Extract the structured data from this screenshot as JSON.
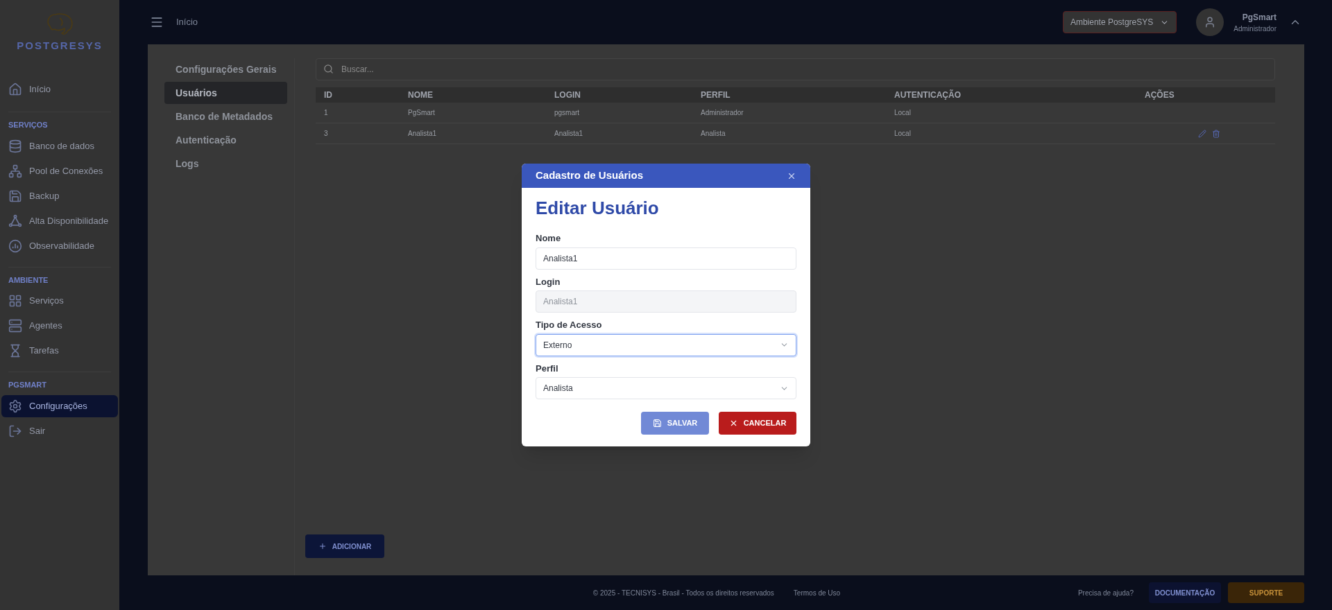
{
  "logo": {
    "text": "POSTGRESYS"
  },
  "sidebar": {
    "groups": [
      {
        "items": [
          {
            "label": "Início",
            "selected": false
          }
        ]
      },
      {
        "heading": "SERVIÇOS",
        "items": [
          {
            "label": "Banco de dados",
            "selected": false
          },
          {
            "label": "Pool de Conexões",
            "selected": false
          },
          {
            "label": "Backup",
            "selected": false
          },
          {
            "label": "Alta Disponibilidade",
            "selected": false
          },
          {
            "label": "Observabilidade",
            "selected": false
          }
        ]
      },
      {
        "heading": "AMBIENTE",
        "items": [
          {
            "label": "Serviços",
            "selected": false
          },
          {
            "label": "Agentes",
            "selected": false
          },
          {
            "label": "Tarefas",
            "selected": false
          }
        ]
      },
      {
        "heading": "PGSMART",
        "items": [
          {
            "label": "Configurações",
            "selected": true
          },
          {
            "label": "Sair",
            "selected": false
          }
        ]
      }
    ]
  },
  "topbar": {
    "breadcrumb": "Início",
    "environment": "Ambiente PostgreSYS",
    "user": {
      "name": "PgSmart",
      "role": "Administrador"
    }
  },
  "settings_nav": [
    {
      "label": "Configurações Gerais",
      "selected": false
    },
    {
      "label": "Usuários",
      "selected": true
    },
    {
      "label": "Banco de Metadados",
      "selected": false
    },
    {
      "label": "Autenticação",
      "selected": false
    },
    {
      "label": "Logs",
      "selected": false
    }
  ],
  "search": {
    "placeholder": "Buscar..."
  },
  "table": {
    "columns": [
      "ID",
      "NOME",
      "LOGIN",
      "PERFIL",
      "AUTENTICAÇÃO",
      "AÇÕES"
    ],
    "rows": [
      {
        "cells": [
          "1",
          "PgSmart",
          "pgsmart",
          "Administrador",
          "Local"
        ],
        "editable": false
      },
      {
        "cells": [
          "3",
          "Analista1",
          "Analista1",
          "Analista",
          "Local"
        ],
        "editable": true
      }
    ]
  },
  "add_button": "ADICIONAR",
  "modal": {
    "header": "Cadastro de Usuários",
    "title": "Editar Usuário",
    "fields": [
      {
        "label": "Nome",
        "kind": "input",
        "value": "Analista1",
        "disabled": false,
        "focused": false
      },
      {
        "label": "Login",
        "kind": "input",
        "value": "Analista1",
        "disabled": true,
        "focused": false
      },
      {
        "label": "Tipo de Acesso",
        "kind": "select",
        "value": "Externo",
        "disabled": false,
        "focused": true
      },
      {
        "label": "Perfil",
        "kind": "select",
        "value": "Analista",
        "disabled": false,
        "focused": false
      }
    ],
    "buttons": [
      {
        "label": "SALVAR",
        "kind": "save"
      },
      {
        "label": "CANCELAR",
        "kind": "cancel"
      }
    ]
  },
  "footer": {
    "copyright": "© 2025 - TECNISYS - Brasil - Todos os direitos reservados",
    "terms": "Termos de Uso",
    "help": "Precisa de ajuda?",
    "buttons": [
      {
        "label": "DOCUMENTAÇÃO",
        "kind": "docs"
      },
      {
        "label": "SUPORTE",
        "kind": "support"
      }
    ]
  }
}
